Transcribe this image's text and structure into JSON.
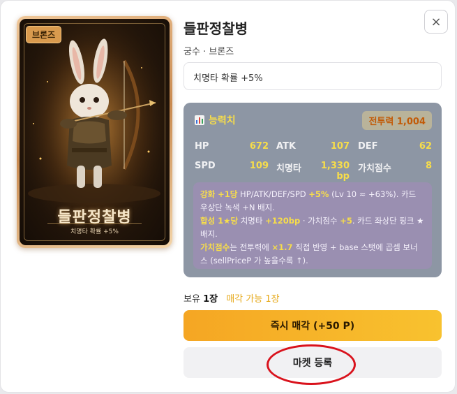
{
  "card": {
    "rarity_badge": "브론즈",
    "name": "들판정찰병",
    "subtitle": "치명타 확률 +5%"
  },
  "detail": {
    "title": "들판정찰병",
    "subtitle": "궁수 · 브론즈",
    "effect": "치명타 확률 +5%",
    "close_icon": "×"
  },
  "stats": {
    "header": "능력치",
    "power_badge": "전투력 1,004",
    "rows": [
      [
        {
          "label": "HP",
          "value": "672"
        },
        {
          "label": "ATK",
          "value": "107"
        },
        {
          "label": "DEF",
          "value": "62"
        }
      ],
      [
        {
          "label": "SPD",
          "value": "109"
        },
        {
          "label": "치명타",
          "value": "1,330 bp"
        },
        {
          "label": "가치점수",
          "value": "8"
        }
      ]
    ],
    "info": {
      "enhance_key": "강화 +1당",
      "enhance_text_1": " HP/ATK/DEF/SPD ",
      "enhance_hl": "+5%",
      "enhance_text_2": " (Lv 10 ≈ +63%). 카드 우상단 녹색 +N 배지.",
      "synth_key": "합성 1★당",
      "synth_text_1": " 치명타 ",
      "synth_hl_1": "+120bp",
      "synth_text_2": " · 가치점수 ",
      "synth_hl_2": "+5",
      "synth_text_3": ". 카드 좌상단 핑크 ★ 배지.",
      "value_key": "가치점수",
      "value_text_1": "는 전투력에 ",
      "value_hl": "×1.7",
      "value_text_2": " 직접 반영 + base 스탯에 곱셈 보너스 (sellPriceP 가 높을수록 ↑)."
    }
  },
  "ownership": {
    "label": "보유",
    "count": "1장",
    "sellable": "매각 가능 1장"
  },
  "buttons": {
    "sell": "즉시 매각 (+50 P)",
    "market": "마켓 등록"
  },
  "colors": {
    "accent_yellow": "#f7dd4a",
    "sell_button": "#f5a623",
    "annotation_red": "#d9121c"
  }
}
